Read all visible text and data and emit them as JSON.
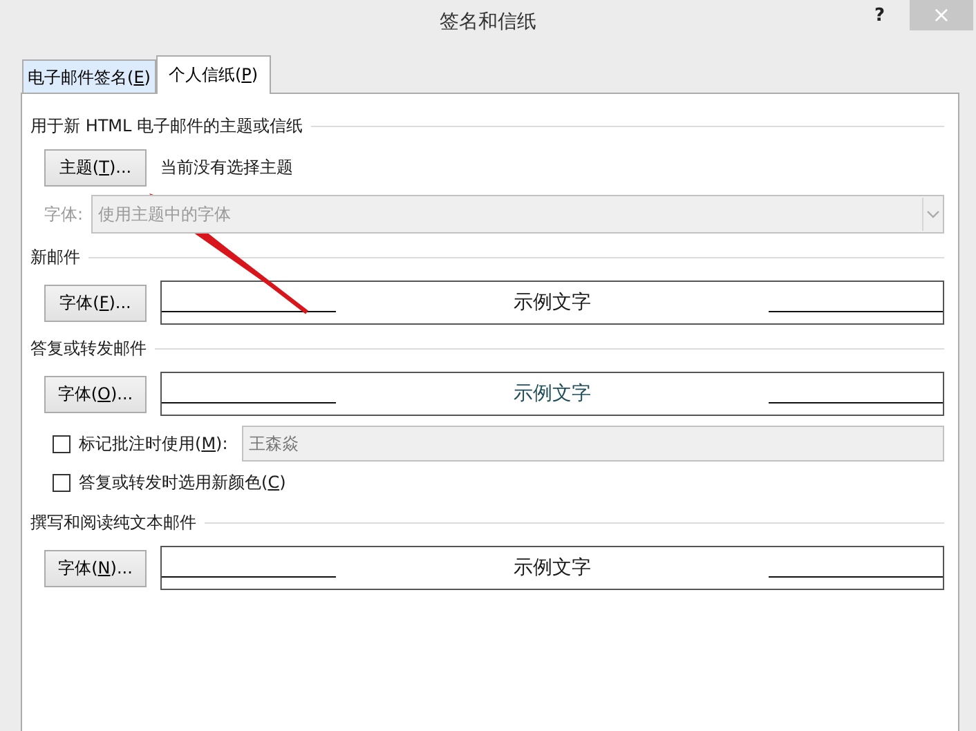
{
  "window": {
    "title": "签名和信纸",
    "help": "?",
    "close": "×"
  },
  "tabs": [
    {
      "before": "电子邮件签名(",
      "key": "E",
      "after": ")",
      "selected": false
    },
    {
      "before": "个人信纸(",
      "key": "P",
      "after": ")",
      "selected": true
    }
  ],
  "sections": [
    {
      "kind": "theme",
      "title": "用于新 HTML 电子邮件的主题或信纸",
      "button": {
        "before": "主题(",
        "key": "T",
        "after": ")..."
      },
      "status": "当前没有选择主题",
      "font_label": "字体:",
      "font_select": {
        "value": "使用主题中的字体",
        "disabled": true
      }
    },
    {
      "kind": "font",
      "title": "新邮件",
      "button": {
        "before": "字体(",
        "key": "F",
        "after": ")..."
      },
      "sample": "示例文字",
      "color": "#1a1a1a"
    },
    {
      "kind": "font",
      "title": "答复或转发邮件",
      "button": {
        "before": "字体(",
        "key": "O",
        "after": ")..."
      },
      "sample": "示例文字",
      "color": "#1f4e5a",
      "options": [
        {
          "kind": "checkbox-field",
          "before": "标记批注时使用(",
          "key": "M",
          "after": "):",
          "checked": false,
          "field": {
            "value": "王森焱",
            "disabled": true
          }
        },
        {
          "kind": "checkbox",
          "before": "答复或转发时选用新颜色(",
          "key": "C",
          "after": ")",
          "checked": false
        }
      ]
    },
    {
      "kind": "font",
      "title": "撰写和阅读纯文本邮件",
      "button": {
        "before": "字体(",
        "key": "N",
        "after": ")..."
      },
      "sample": "示例文字",
      "color": "#1a1a1a"
    }
  ]
}
